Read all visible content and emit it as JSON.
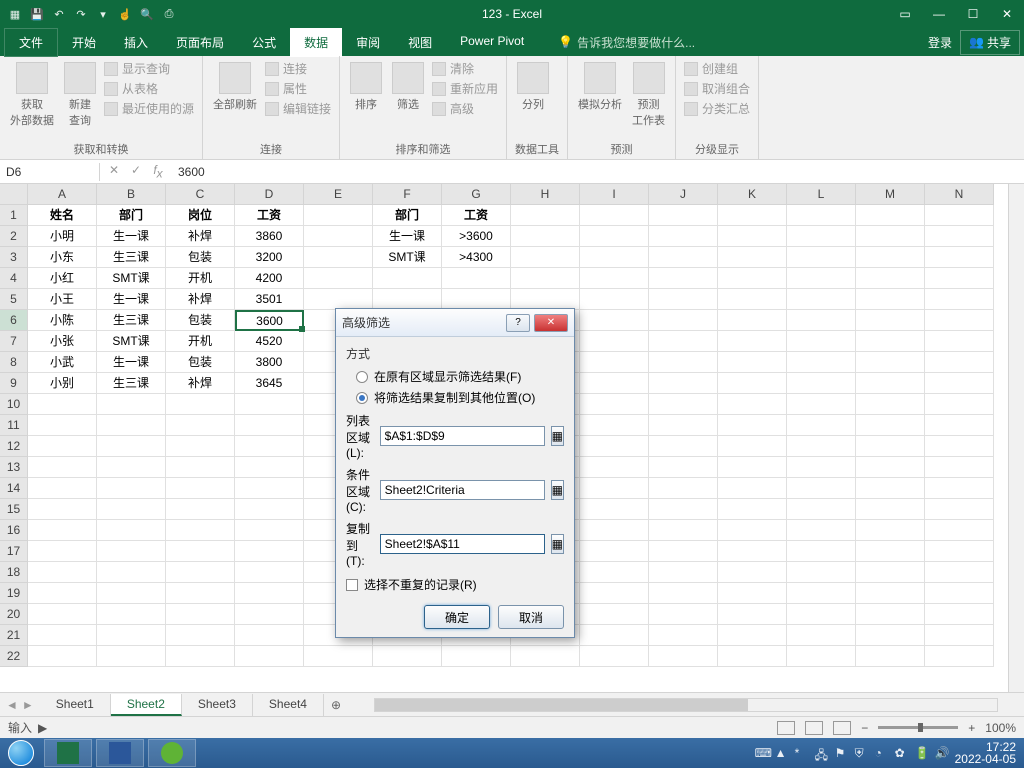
{
  "title": "123 - Excel",
  "qat_icons": [
    "save",
    "undo",
    "redo",
    "touch",
    "preview",
    "print"
  ],
  "tabs": {
    "file": "文件",
    "list": [
      "开始",
      "插入",
      "页面布局",
      "公式",
      "数据",
      "审阅",
      "视图",
      "Power Pivot"
    ],
    "active": "数据",
    "tellme": "告诉我您想要做什么...",
    "login": "登录",
    "share": "共享"
  },
  "ribbon_groups": [
    {
      "label": "获取和转换",
      "big": [
        {
          "name": "获取\n外部数据"
        },
        {
          "name": "新建\n查询"
        }
      ],
      "small": [
        "显示查询",
        "从表格",
        "最近使用的源"
      ]
    },
    {
      "label": "连接",
      "big": [
        {
          "name": "全部刷新"
        }
      ],
      "small": [
        "连接",
        "属性",
        "编辑链接"
      ]
    },
    {
      "label": "排序和筛选",
      "big": [
        {
          "name": "排序"
        },
        {
          "name": "筛选"
        }
      ],
      "small": [
        "清除",
        "重新应用",
        "高级"
      ]
    },
    {
      "label": "数据工具",
      "big": [
        {
          "name": "分列"
        }
      ],
      "small": []
    },
    {
      "label": "预测",
      "big": [
        {
          "name": "模拟分析"
        },
        {
          "name": "预测\n工作表"
        }
      ],
      "small": []
    },
    {
      "label": "分级显示",
      "big": [],
      "small": [
        "创建组",
        "取消组合",
        "分类汇总"
      ]
    }
  ],
  "namebox": "D6",
  "formula": "3600",
  "columns": [
    "A",
    "B",
    "C",
    "D",
    "E",
    "F",
    "G",
    "H",
    "I",
    "J",
    "K",
    "L",
    "M",
    "N"
  ],
  "rows": 22,
  "selected_row": 6,
  "selected_cell": "D6",
  "data_rows": [
    {
      "r": 1,
      "cells": {
        "A": "姓名",
        "B": "部门",
        "C": "岗位",
        "D": "工资",
        "F": "部门",
        "G": "工资"
      },
      "bold": true
    },
    {
      "r": 2,
      "cells": {
        "A": "小明",
        "B": "生一课",
        "C": "补焊",
        "D": "3860",
        "F": "生一课",
        "G": ">3600"
      }
    },
    {
      "r": 3,
      "cells": {
        "A": "小东",
        "B": "生三课",
        "C": "包装",
        "D": "3200",
        "F": "SMT课",
        "G": ">4300"
      }
    },
    {
      "r": 4,
      "cells": {
        "A": "小红",
        "B": "SMT课",
        "C": "开机",
        "D": "4200"
      }
    },
    {
      "r": 5,
      "cells": {
        "A": "小王",
        "B": "生一课",
        "C": "补焊",
        "D": "3501"
      }
    },
    {
      "r": 6,
      "cells": {
        "A": "小陈",
        "B": "生三课",
        "C": "包装",
        "D": "3600"
      }
    },
    {
      "r": 7,
      "cells": {
        "A": "小张",
        "B": "SMT课",
        "C": "开机",
        "D": "4520"
      }
    },
    {
      "r": 8,
      "cells": {
        "A": "小武",
        "B": "生一课",
        "C": "包装",
        "D": "3800"
      }
    },
    {
      "r": 9,
      "cells": {
        "A": "小别",
        "B": "生三课",
        "C": "补焊",
        "D": "3645"
      }
    }
  ],
  "sheet_tabs": [
    "Sheet1",
    "Sheet2",
    "Sheet3",
    "Sheet4"
  ],
  "active_sheet": "Sheet2",
  "status": "输入",
  "zoom": "100%",
  "dialog": {
    "title": "高级筛选",
    "section": "方式",
    "radio1": "在原有区域显示筛选结果(F)",
    "radio2": "将筛选结果复制到其他位置(O)",
    "radio_checked": 2,
    "field1_label": "列表区域(L):",
    "field1_value": "$A$1:$D$9",
    "field2_label": "条件区域(C):",
    "field2_value": "Sheet2!Criteria",
    "field3_label": "复制到(T):",
    "field3_value": "Sheet2!$A$11",
    "checkbox": "选择不重复的记录(R)",
    "ok": "确定",
    "cancel": "取消"
  },
  "taskbar": {
    "time": "17:22",
    "date": "2022-04-05"
  }
}
